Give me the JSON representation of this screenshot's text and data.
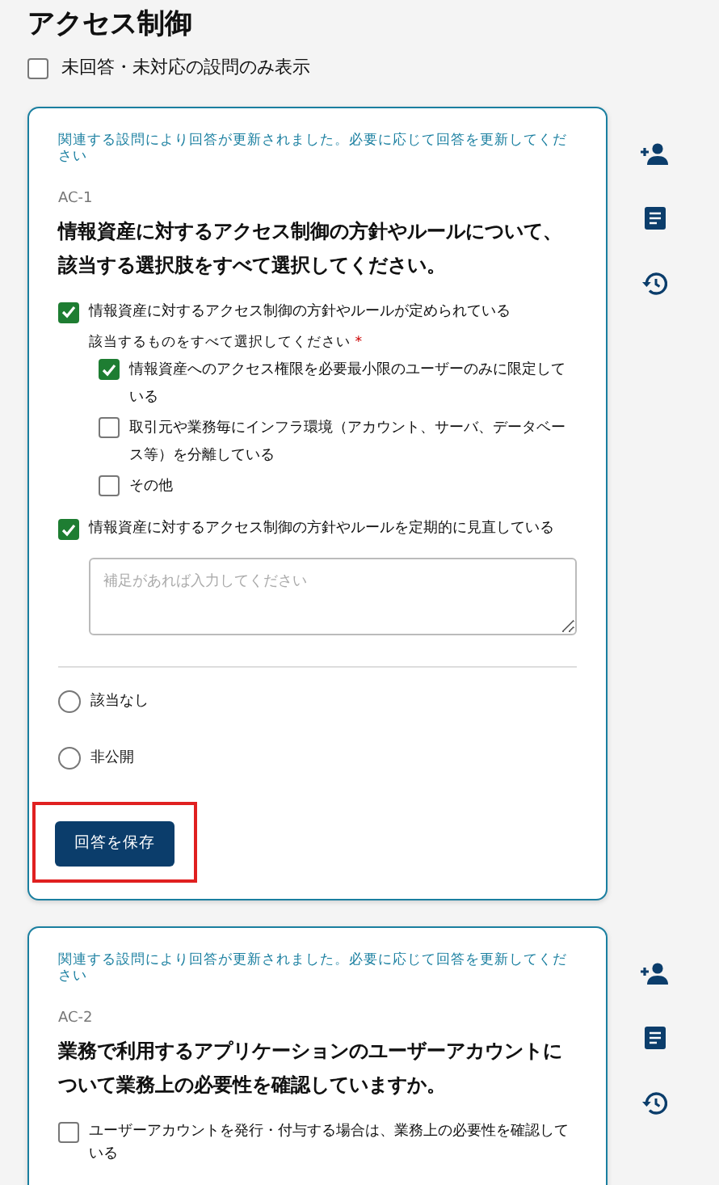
{
  "page_title": "アクセス制御",
  "filter": {
    "label": "未回答・未対応の設問のみ表示",
    "checked": false
  },
  "questions": [
    {
      "notice": "関連する設問により回答が更新されました。必要に応じて回答を更新してください",
      "code": "AC-1",
      "text": "情報資産に対するアクセス制御の方針やルールについて、該当する選択肢をすべて選択してください。",
      "options": [
        {
          "kind": "checkbox",
          "label": "情報資産に対するアクセス制御の方針やルールが定められている",
          "checked": true,
          "sub_prompt": "該当するものをすべて選択してください",
          "required_mark": "*",
          "sub_options": [
            {
              "label": "情報資産へのアクセス権限を必要最小限のユーザーのみに限定している",
              "checked": true
            },
            {
              "label": "取引元や業務毎にインフラ環境（アカウント、サーバ、データベース等）を分離している",
              "checked": false
            },
            {
              "label": "その他",
              "checked": false
            }
          ]
        },
        {
          "kind": "checkbox",
          "label": "情報資産に対するアクセス制御の方針やルールを定期的に見直している",
          "checked": true,
          "note_placeholder": "補足があれば入力してください"
        },
        {
          "kind": "radio",
          "label": "該当なし",
          "selected": false
        },
        {
          "kind": "radio",
          "label": "非公開",
          "selected": false
        }
      ],
      "save_button": {
        "label": "回答を保存",
        "highlighted": true
      }
    },
    {
      "notice": "関連する設問により回答が更新されました。必要に応じて回答を更新してください",
      "code": "AC-2",
      "text": "業務で利用するアプリケーションのユーザーアカウントについて業務上の必要性を確認していますか。",
      "options": [
        {
          "kind": "checkbox",
          "label": "ユーザーアカウントを発行・付与する場合は、業務上の必要性を確認している",
          "checked": false
        }
      ]
    }
  ]
}
